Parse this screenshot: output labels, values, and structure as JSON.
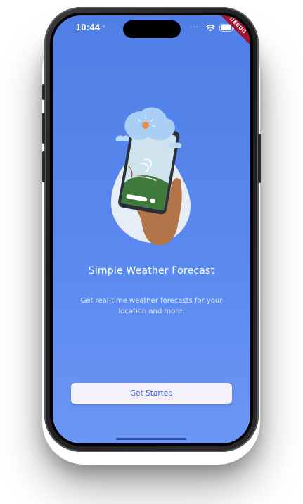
{
  "status_bar": {
    "time": "10:44",
    "signal_dots": "····"
  },
  "debug_banner": {
    "label": "DEBUG"
  },
  "onboarding": {
    "title": "Simple Weather Forecast",
    "subtitle": "Get real-time weather forecasts for your location and more.",
    "get_started_label": "Get Started"
  },
  "colors": {
    "screen_gradient_top": "#4f7fe6",
    "screen_gradient_bottom": "#6b97f5",
    "button_background": "#f4f1fb",
    "button_text": "#3d5fcf",
    "debug_banner": "#a0142e"
  },
  "icons": {
    "location": "location-arrow-icon",
    "wifi": "wifi-icon",
    "battery": "battery-icon",
    "illustration": "weather-phone-hand-illustration"
  }
}
